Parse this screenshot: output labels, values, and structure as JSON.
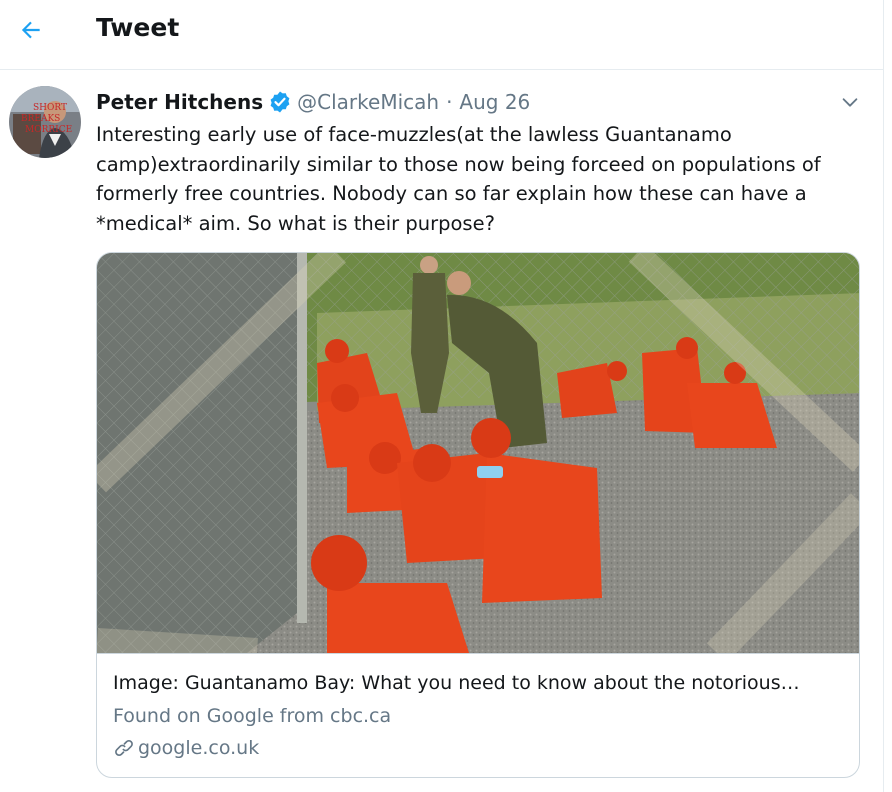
{
  "header": {
    "title": "Tweet",
    "back_icon": "back-arrow-icon"
  },
  "tweet": {
    "author_name": "Peter Hitchens",
    "verified_icon": "verified-badge-icon",
    "handle": "@ClarkeMicah",
    "separator": "·",
    "date": "Aug 26",
    "more_icon": "chevron-down-icon",
    "avatar_text": [
      "SHORT",
      "BREAKS",
      "MORRICE"
    ],
    "text_lines": [
      "Interesting early use of face-muzzles(at the lawless Guantanamo",
      "camp)extraordinarily similar to those now being forceed on populations of",
      "formerly free countries. Nobody can so far explain how these can have a",
      "*medical* aim. So what is their purpose?"
    ]
  },
  "card": {
    "title": "Image: Guantanamo Bay: What you need to know about the notorious…",
    "subtitle": "Found on Google from cbc.ca",
    "domain": "google.co.uk",
    "link_icon": "link-icon"
  },
  "colors": {
    "accent": "#1da1f2",
    "text": "#14171a",
    "muted": "#657786",
    "border": "#e6ecf0",
    "detainee_orange": "#e8461c"
  }
}
